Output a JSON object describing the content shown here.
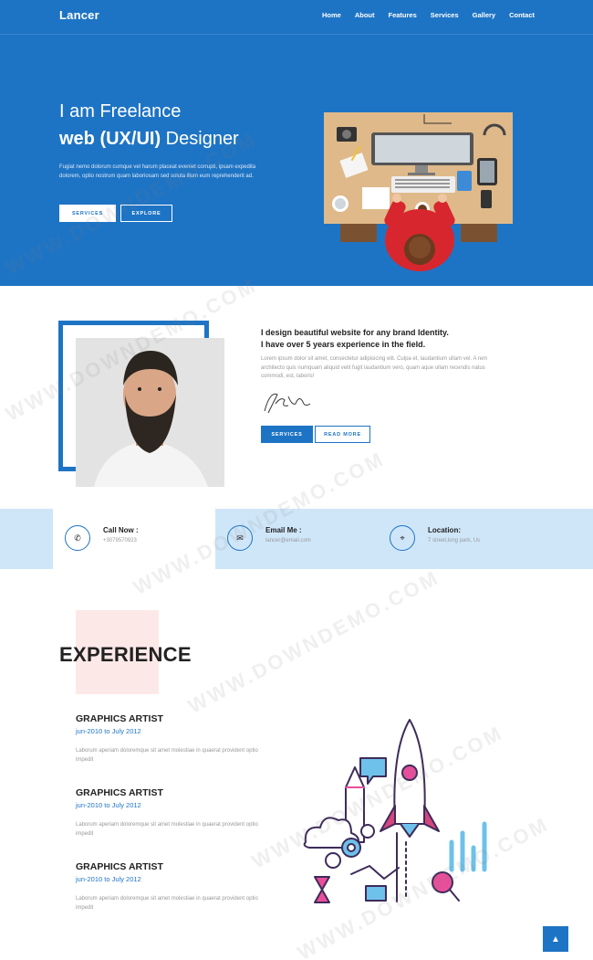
{
  "nav": {
    "logo": "Lancer",
    "items": [
      "Home",
      "About",
      "Features",
      "Services",
      "Gallery",
      "Contact"
    ]
  },
  "hero": {
    "line1": "I am Freelance",
    "line2_bold": "web (UX/UI)",
    "line2_rest": " Designer",
    "paragraph": "Fugiat nemo dolorum cumque vel harum placeat eveniet corrupti, ipsam expedita dolorem, optio nostrum quam laboriosam sed soluta illum eum reprehenderit ad.",
    "btn_services": "Services",
    "btn_explore": "Explore"
  },
  "about": {
    "title_line1": "I design beautiful website for any brand Identity.",
    "title_line2": "I have over 5 years experience in the field.",
    "paragraph": "Lorem ipsum dolor sit amet, consectetur adipisicing elit. Culpa et, laudantium ullam vel. A rem architecto quis numquam aliquid velit fugit laudantium vero, quam aque ullam recendis natus commodi, est, laboris!",
    "btn_services": "Services",
    "btn_read": "Read More"
  },
  "contact": {
    "call_label": "Call Now :",
    "call_value": "+3079570923",
    "email_label": "Email Me :",
    "email_value": "lancer@email.com",
    "location_label": "Location:",
    "location_value": "7 street,long park, Us"
  },
  "experience": {
    "title": "EXPERIENCE",
    "jobs": [
      {
        "title": "GRAPHICS ARTIST",
        "date": "jun-2010 to July 2012",
        "text": "Laborum aperiam doloremque sit amet molestiae in quaerat provident optio impedit"
      },
      {
        "title": "GRAPHICS ARTIST",
        "date": "jun-2010 to July 2012",
        "text": "Laborum aperiam doloremque sit amet molestiae in quaerat provident optio impedit"
      },
      {
        "title": "GRAPHICS ARTIST",
        "date": "jun-2010 to July 2012",
        "text": "Laborum aperiam doloremque sit amet molestiae in quaerat provident optio impedit"
      }
    ]
  },
  "watermark": "WWW.DOWNDEMO.COM",
  "colors": {
    "primary": "#1e74c4",
    "strip": "#cfe6f9",
    "accent_block": "#fde8e8"
  },
  "icons": {
    "phone": "phone-icon",
    "email": "envelope-icon",
    "location": "location-icon",
    "back_to_top": "arrow-up-icon"
  }
}
